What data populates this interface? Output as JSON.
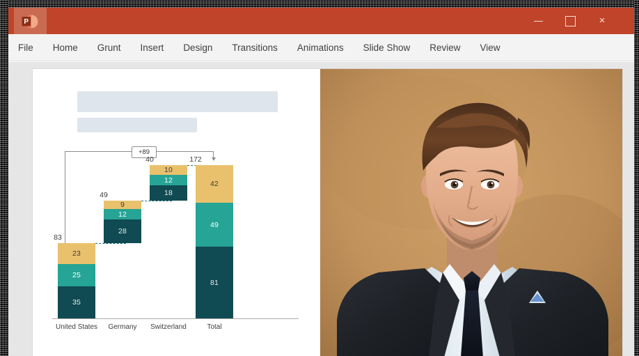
{
  "window": {
    "app_icon": "powerpoint-icon",
    "controls": {
      "minimize": "–",
      "maximize": "□",
      "close": "×"
    }
  },
  "menu": {
    "items": [
      {
        "label": "File"
      },
      {
        "label": "Home"
      },
      {
        "label": "Grunt"
      },
      {
        "label": "Insert"
      },
      {
        "label": "Design"
      },
      {
        "label": "Transitions"
      },
      {
        "label": "Animations"
      },
      {
        "label": "Slide Show"
      },
      {
        "label": "Review"
      },
      {
        "label": "View"
      }
    ]
  },
  "slide": {
    "title_placeholder": "",
    "subtitle_placeholder": "",
    "photo_alt": "smiling businessman in dark suit on tan background"
  },
  "chart_data": {
    "type": "bar",
    "subtype": "stacked-waterfall",
    "title": "",
    "xlabel": "",
    "ylabel": "",
    "grid": false,
    "legend": "none",
    "categories": [
      "United States",
      "Germany",
      "Switzerland",
      "Total"
    ],
    "series": [
      {
        "name": "dark",
        "color": "#104a52",
        "values": [
          35,
          28,
          18,
          81
        ]
      },
      {
        "name": "teal",
        "color": "#26a495",
        "values": [
          25,
          12,
          12,
          49
        ]
      },
      {
        "name": "gold",
        "color": "#e9c16c",
        "values": [
          23,
          9,
          10,
          42
        ]
      }
    ],
    "totals": [
      83,
      49,
      40,
      172
    ],
    "ylim": [
      0,
      172
    ],
    "annotation": {
      "label": "+89",
      "from": "United States",
      "to": "Total"
    },
    "colors": {
      "dark": "#104a52",
      "teal": "#26a495",
      "gold": "#e9c16c",
      "connector": "#1d6a74",
      "callout": "#8c8c8c",
      "axis": "#a9a9a9"
    }
  },
  "theme": {
    "titlebar": "#c0442a",
    "menubar": "#f3f3f3",
    "workspace": "#e6e6e6",
    "placeholder": "#dfe5ec"
  }
}
